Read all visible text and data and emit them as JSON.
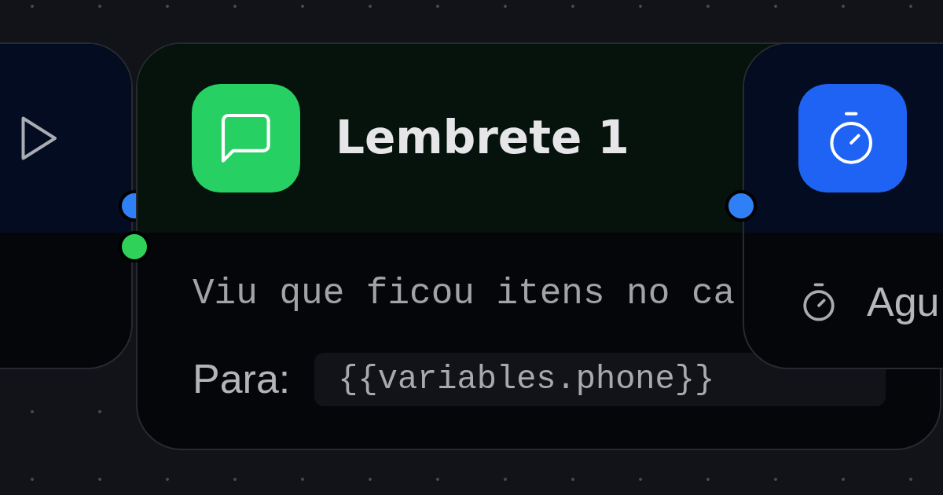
{
  "nodes": [
    {
      "kind": "trigger",
      "handles": [
        {
          "color": "#2f80f7"
        }
      ]
    },
    {
      "kind": "message",
      "title": "Lembrete 1",
      "message": "Viu que ficou itens no ca",
      "recipient_label": "Para:",
      "recipient": "{{variables.phone}}",
      "handles": [
        {
          "color": "#2fd158"
        }
      ]
    },
    {
      "kind": "delay",
      "detail": "Agu",
      "handles": [
        {
          "color": "#2f80f7"
        }
      ]
    }
  ]
}
